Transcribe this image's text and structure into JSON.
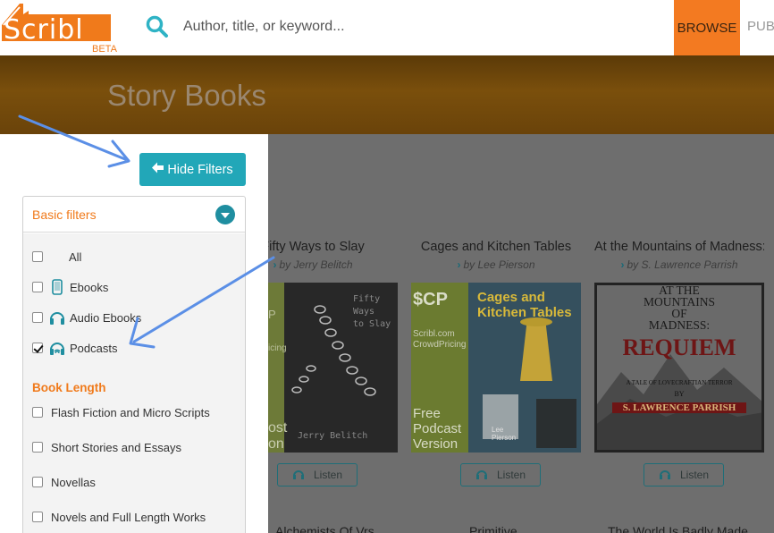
{
  "header": {
    "logo_text": "Scribl",
    "beta_label": "BETA",
    "search_placeholder": "Author, title, or keyword...",
    "browse_label": "BROWSE",
    "pub_label": "PUB"
  },
  "banner": {
    "title": "Story Books"
  },
  "filters": {
    "hide_label": "Hide Filters",
    "basic_label": "Basic filters",
    "format_options": [
      {
        "label": "All",
        "checked": false,
        "icon": "none"
      },
      {
        "label": "Ebooks",
        "checked": false,
        "icon": "tablet-icon"
      },
      {
        "label": "Audio Ebooks",
        "checked": false,
        "icon": "headphones-icon"
      },
      {
        "label": "Podcasts",
        "checked": true,
        "icon": "podcast-icon"
      }
    ],
    "length_label": "Book Length",
    "length_options": [
      {
        "label": "Flash Fiction and Micro Scripts",
        "checked": false
      },
      {
        "label": "Short Stories and Essays",
        "checked": false
      },
      {
        "label": "Novellas",
        "checked": false
      },
      {
        "label": "Novels and Full Length Works",
        "checked": false
      }
    ]
  },
  "books": [
    {
      "title": "Fifty Ways to Slay",
      "author": "by Jerry Belitch",
      "cover_text": [
        "Fifty",
        "Ways",
        "to Slay"
      ],
      "cover_author": "Jerry Belitch",
      "cover_side_text": [
        "P",
        "icing",
        "ost",
        "on"
      ],
      "listen_label": "Listen"
    },
    {
      "title": "Cages and Kitchen Tables",
      "author": "by Lee Pierson",
      "cover_logo": "$CP",
      "cover_sub": [
        "Scribl.com",
        "CrowdPricing"
      ],
      "cover_title": [
        "Cages and",
        "Kitchen Tables"
      ],
      "cover_free": [
        "Free",
        "Podcast",
        "Version"
      ],
      "cover_author": [
        "Lee",
        "Pierson"
      ],
      "listen_label": "Listen"
    },
    {
      "title": "At the Mountains of Madness: Requiem",
      "author": "by S. Lawrence Parrish",
      "cover_title": [
        "AT THE",
        "MOUNTAINS",
        "OF",
        "MADNESS:"
      ],
      "cover_requiem": "REQUIEM",
      "cover_tagline": "A TALE OF LOVECRAFTIAN TERROR",
      "cover_by": "BY",
      "cover_author": "S. LAWRENCE PARRISH",
      "listen_label": "Listen"
    }
  ],
  "next_row": [
    "Alchemists Of Vrs",
    "Primitive",
    "The World Is Badly Made"
  ],
  "colors": {
    "accent_orange": "#f37a21",
    "teal": "#22a7b8",
    "arrow_blue": "#5b8fe6"
  }
}
